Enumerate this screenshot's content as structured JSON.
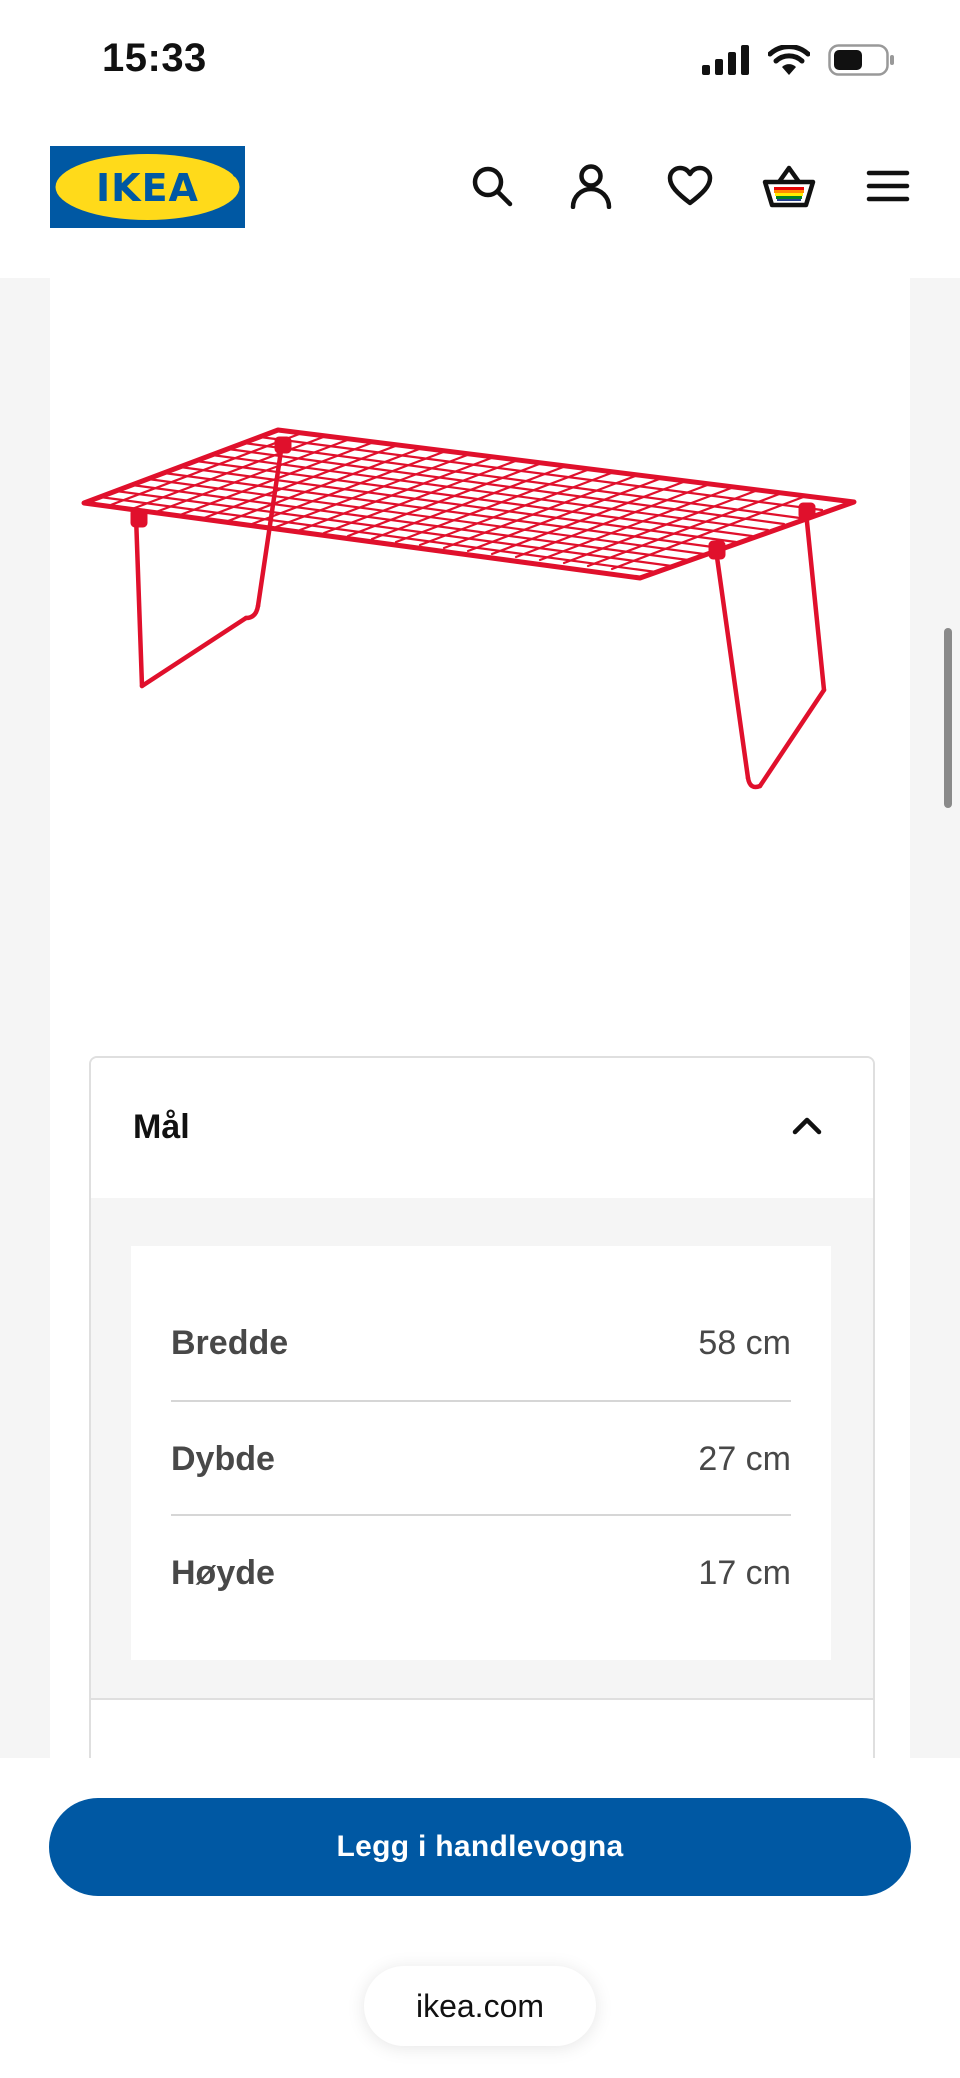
{
  "status_bar": {
    "time": "15:33",
    "icons": [
      "cellular-signal-icon",
      "wifi-icon",
      "battery-icon"
    ]
  },
  "header": {
    "logo_text": "IKEA",
    "nav_icons": [
      "search-icon",
      "account-icon",
      "heart-icon",
      "shopping-basket-icon",
      "menu-icon"
    ]
  },
  "colors": {
    "ikea_blue": "#0058a3",
    "ikea_yellow": "#ffda1a",
    "product_red": "#e0102c"
  },
  "dimensions": {
    "title": "Mål",
    "expanded": true,
    "rows": [
      {
        "label": "Bredde",
        "value": "58 cm"
      },
      {
        "label": "Dybde",
        "value": "27 cm"
      },
      {
        "label": "Høyde",
        "value": "17 cm"
      }
    ]
  },
  "bottom": {
    "cart_button_label": "Legg i handlevogna",
    "url": "ikea.com"
  }
}
